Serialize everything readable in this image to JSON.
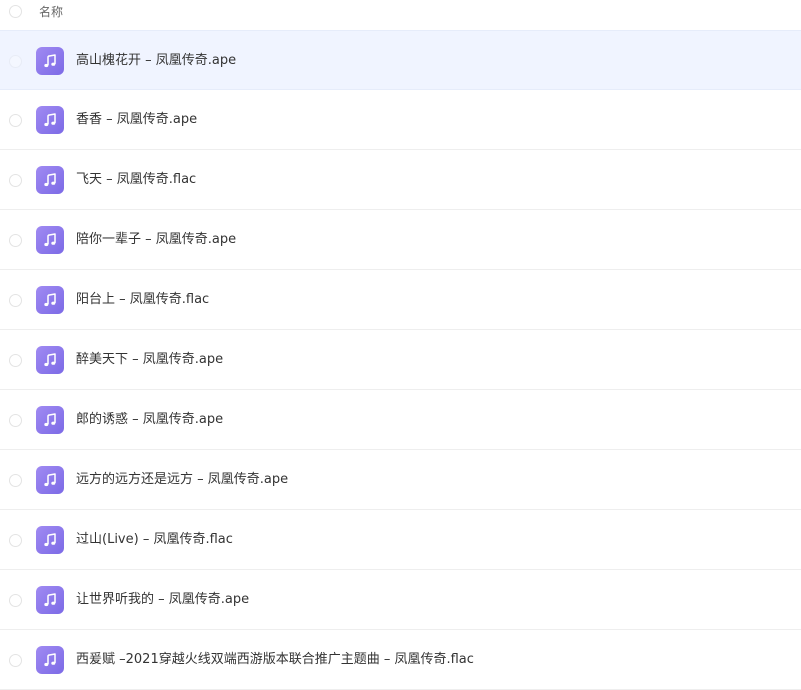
{
  "header": {
    "column_name_label": "名称"
  },
  "file_icon": "music-note-icon",
  "colors": {
    "selected_row_bg": "#f0f4ff",
    "icon_gradient_start": "#a08af2",
    "icon_gradient_end": "#7c6ae6"
  },
  "files": [
    {
      "name": "高山槐花开 – 凤凰传奇.ape",
      "selected": true
    },
    {
      "name": "香香 – 凤凰传奇.ape",
      "selected": false
    },
    {
      "name": "飞天 – 凤凰传奇.flac",
      "selected": false
    },
    {
      "name": "陪你一辈子 – 凤凰传奇.ape",
      "selected": false
    },
    {
      "name": "阳台上 – 凤凰传奇.flac",
      "selected": false
    },
    {
      "name": "醉美天下 – 凤凰传奇.ape",
      "selected": false
    },
    {
      "name": "郎的诱惑 – 凤凰传奇.ape",
      "selected": false
    },
    {
      "name": "远方的远方还是远方 – 凤凰传奇.ape",
      "selected": false
    },
    {
      "name": "过山(Live) – 凤凰传奇.flac",
      "selected": false
    },
    {
      "name": "让世界听我的 – 凤凰传奇.ape",
      "selected": false
    },
    {
      "name": "西爰赋 –2021穿越火线双端西游版本联合推广主题曲 – 凤凰传奇.flac",
      "selected": false
    }
  ]
}
